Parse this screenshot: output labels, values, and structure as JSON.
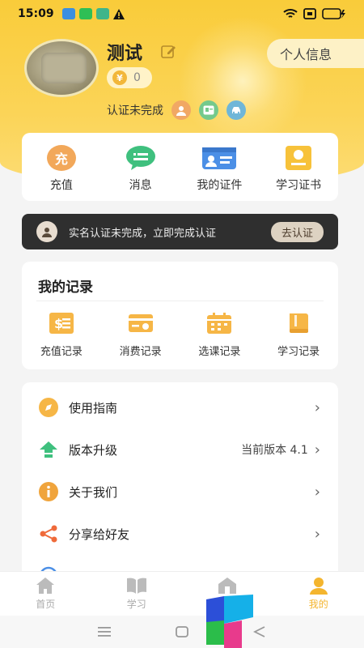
{
  "status_bar": {
    "time": "15:09"
  },
  "profile": {
    "username": "测试",
    "coins": "0",
    "coin_symbol": "¥",
    "profile_button": "个人信息",
    "verify_text": "认证未完成"
  },
  "quick_actions": [
    {
      "label": "充值",
      "icon": "recharge-icon",
      "glyph": "充"
    },
    {
      "label": "消息",
      "icon": "message-icon"
    },
    {
      "label": "我的证件",
      "icon": "id-card-icon"
    },
    {
      "label": "学习证书",
      "icon": "certificate-icon"
    }
  ],
  "banner": {
    "text": "实名认证未完成，立即完成认证",
    "button": "去认证"
  },
  "records": {
    "title": "我的记录",
    "items": [
      {
        "label": "充值记录",
        "icon": "recharge-record-icon",
        "glyph": "$"
      },
      {
        "label": "消费记录",
        "icon": "consume-record-icon"
      },
      {
        "label": "选课记录",
        "icon": "course-record-icon"
      },
      {
        "label": "学习记录",
        "icon": "study-record-icon"
      }
    ]
  },
  "menu": [
    {
      "label": "使用指南",
      "icon": "compass-icon",
      "extra": ""
    },
    {
      "label": "版本升级",
      "icon": "upgrade-icon",
      "extra": "当前版本 4.1"
    },
    {
      "label": "关于我们",
      "icon": "info-icon",
      "extra": ""
    },
    {
      "label": "分享给好友",
      "icon": "share-icon",
      "extra": ""
    }
  ],
  "tabs": [
    {
      "label": "首页",
      "icon": "home-icon"
    },
    {
      "label": "学习",
      "icon": "book-icon"
    },
    {
      "label": "",
      "icon": "house-icon"
    },
    {
      "label": "我的",
      "icon": "user-icon"
    }
  ],
  "colors": {
    "accent": "#f9cc3a",
    "tab_active": "#f4b52e",
    "banner_bg": "#2f2f2f"
  }
}
